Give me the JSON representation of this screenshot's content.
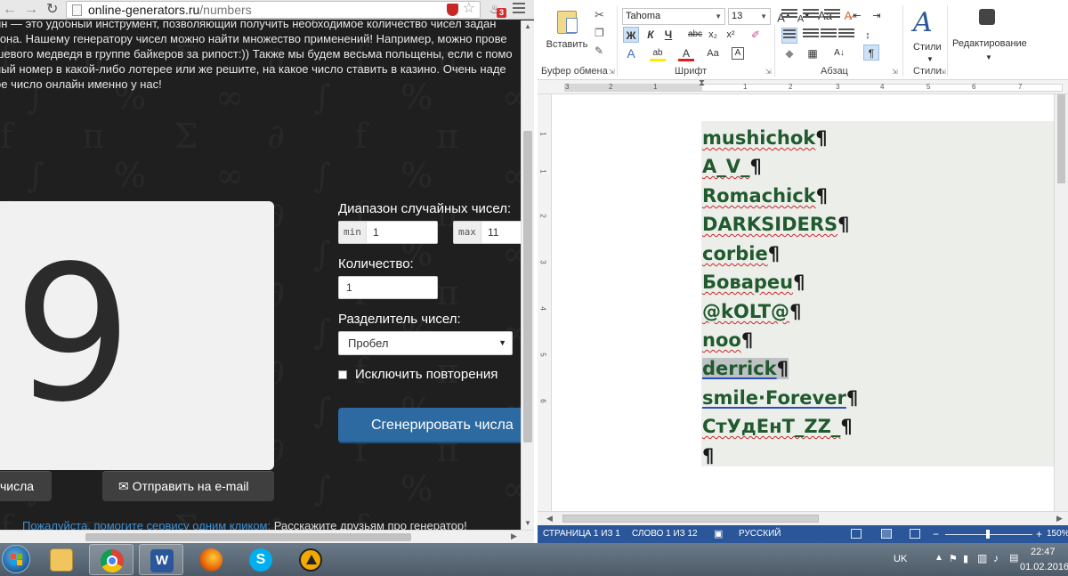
{
  "browser": {
    "address": {
      "host": "online-generators.ru",
      "path": "/numbers"
    },
    "extension_badge": "3",
    "intro_lines": [
      "ин  — это удобный инструмент, позволяющий получить необходимое количество чисел задан",
      "зона. Нашему генератору чисел можно найти множество применений! Например, можно прове",
      "шевого медведя в группе байкеров за рипост:)) Также мы будем весьма польщены, если с помо",
      "ный номер в какой-либо лотерее или же решите, на какое число ставить в казино. Очень наде",
      "ое число онлайн именно у нас!"
    ],
    "result_number": "9",
    "range_label": "Диапазон случайных чисел:",
    "min_prefix": "min",
    "min_value": "1",
    "max_prefix": "max",
    "max_value": "11",
    "count_label": "Количество:",
    "count_value": "1",
    "separator_label": "Разделитель чисел:",
    "separator_value": "Пробел",
    "no_repeat_label": "Исключить повторения",
    "generate_button": "Сгенерировать числа",
    "copy_button": "числа",
    "email_button": "✉ Отправить на e-mail",
    "help_link": "Пожалуйста, помогите сервису одним кликом:",
    "help_text": " Расскажите друзьям про генератор!"
  },
  "word": {
    "clipboard": {
      "paste_label": "Вставить",
      "group_label": "Буфер обмена"
    },
    "font": {
      "name": "Tahoma",
      "size": "13",
      "group_label": "Шрифт",
      "buttons": [
        "Ж",
        "К",
        "Ч",
        "abc",
        "x₂",
        "x²",
        "A",
        "ab",
        "A",
        "Aa"
      ]
    },
    "paragraph": {
      "group_label": "Абзац",
      "pilcrow": "¶"
    },
    "styles": {
      "label": "Стили",
      "group_label": "Стили"
    },
    "editing": {
      "label": "Редактирование"
    },
    "ruler_marks": [
      "3",
      "2",
      "1",
      "1",
      "2",
      "3",
      "4",
      "5",
      "6",
      "7"
    ],
    "vruler_marks": [
      "1",
      "1",
      "2",
      "3",
      "4",
      "5",
      "6"
    ],
    "lines": [
      {
        "text": "mushichok",
        "mark": "¶"
      },
      {
        "text": "A_V_",
        "mark": "¶"
      },
      {
        "text": "Romachick",
        "mark": "¶"
      },
      {
        "text": "DARKSIDERS",
        "mark": "¶"
      },
      {
        "text": "corbie",
        "mark": "¶"
      },
      {
        "text": "Бовареu",
        "mark": "¶"
      },
      {
        "text": "@kOLT@",
        "mark": "¶"
      },
      {
        "text": "noo",
        "mark": "¶"
      },
      {
        "text": "derrick",
        "mark": "¶"
      },
      {
        "text": "smile·Forever",
        "mark": "¶"
      },
      {
        "text": "СтУдЕнТ_ZZ_",
        "mark": "¶"
      },
      {
        "text": "",
        "mark": "¶"
      }
    ],
    "status": {
      "page": "СТРАНИЦА 1 ИЗ 1",
      "words": "СЛОВО 1 ИЗ 12",
      "language": "РУССКИЙ",
      "zoom": "150%"
    }
  },
  "taskbar": {
    "language": "UK",
    "time": "22:47",
    "date": "01.02.2016"
  },
  "colors": {
    "word_text": "#205a2e",
    "status_bar": "#2b579a",
    "generate_button": "#2c6aa1"
  }
}
